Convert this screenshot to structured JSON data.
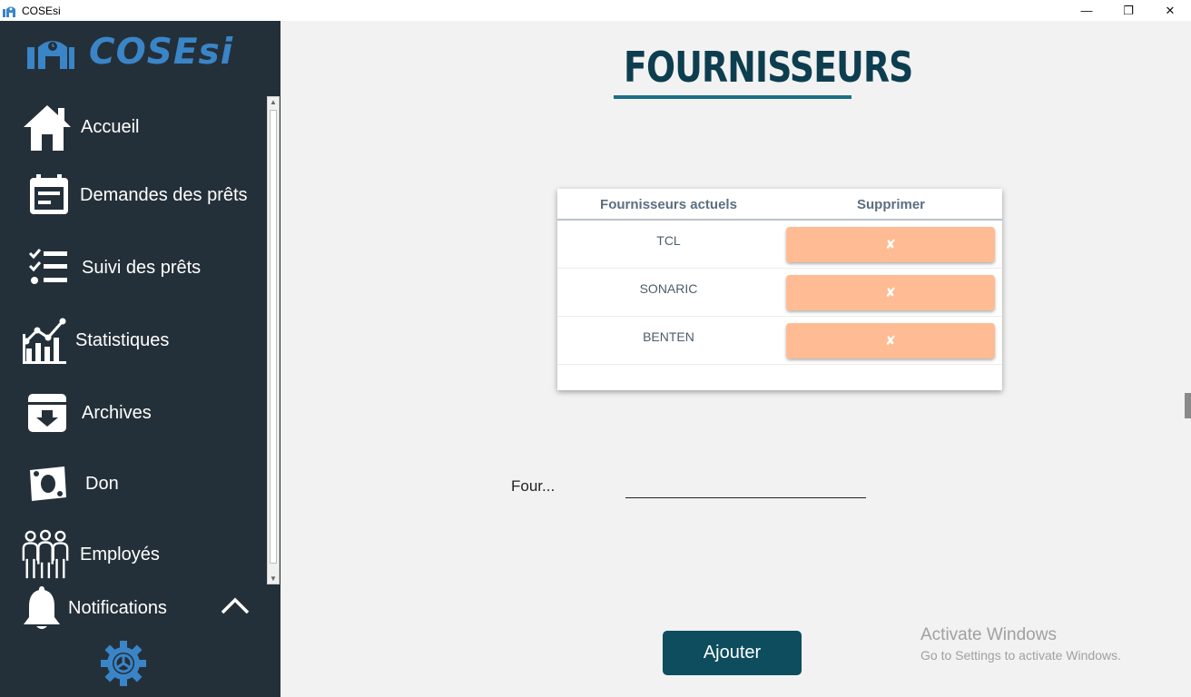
{
  "window": {
    "title": "COSEsi",
    "minimize": "—",
    "restore": "❐",
    "close": "✕"
  },
  "sidebar": {
    "logo_text": "COSEsi",
    "items": [
      {
        "label": "Accueil",
        "icon": "home-icon"
      },
      {
        "label": "Demandes des prêts",
        "icon": "calendar-form-icon"
      },
      {
        "label": "Suivi des prêts",
        "icon": "checklist-icon"
      },
      {
        "label": "Statistiques",
        "icon": "bar-chart-icon"
      },
      {
        "label": "Archives",
        "icon": "archive-icon"
      },
      {
        "label": "Don",
        "icon": "money-icon"
      },
      {
        "label": "Employés",
        "icon": "employees-icon"
      },
      {
        "label": "Notifications",
        "icon": "bell-icon"
      }
    ],
    "settings_icon": "gear-icon"
  },
  "main": {
    "page_title": "FOURNISSEURS",
    "table": {
      "columns": [
        "Fournisseurs actuels",
        "Supprimer"
      ],
      "rows": [
        {
          "name": "TCL",
          "action": "✘"
        },
        {
          "name": "SONARIC",
          "action": "✘"
        },
        {
          "name": "BENTEN",
          "action": "✘"
        }
      ]
    },
    "form": {
      "label": "Four...",
      "value": ""
    },
    "add_button": "Ajouter"
  },
  "watermark": {
    "line1": "Activate Windows",
    "line2": "Go to Settings to activate Windows."
  },
  "colors": {
    "sidebar_bg": "#243039",
    "logo_blue": "#3a85c8",
    "title_color": "#0d3e4f",
    "delete_button": "#ffbc94",
    "add_button": "#0d4d5e"
  }
}
